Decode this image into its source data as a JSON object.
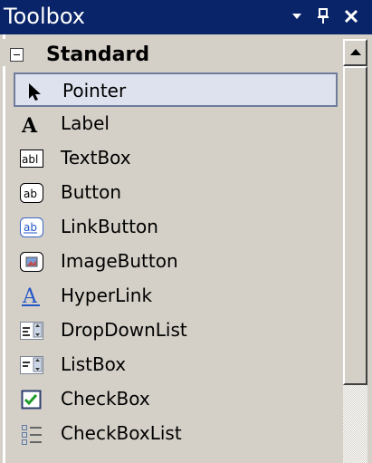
{
  "window": {
    "title": "Toolbox",
    "controls": {
      "dropdown": "▾",
      "pin": "ᚁ",
      "close": "✕"
    }
  },
  "group": {
    "label": "Standard",
    "expanded": true
  },
  "items": [
    {
      "label": "Pointer",
      "icon": "pointer-icon",
      "selected": true
    },
    {
      "label": "Label",
      "icon": "label-icon"
    },
    {
      "label": "TextBox",
      "icon": "textbox-icon"
    },
    {
      "label": "Button",
      "icon": "button-icon"
    },
    {
      "label": "LinkButton",
      "icon": "linkbutton-icon"
    },
    {
      "label": "ImageButton",
      "icon": "imagebutton-icon"
    },
    {
      "label": "HyperLink",
      "icon": "hyperlink-icon"
    },
    {
      "label": "DropDownList",
      "icon": "dropdownlist-icon"
    },
    {
      "label": "ListBox",
      "icon": "listbox-icon"
    },
    {
      "label": "CheckBox",
      "icon": "checkbox-icon"
    },
    {
      "label": "CheckBoxList",
      "icon": "checkboxlist-icon"
    }
  ],
  "colors": {
    "titlebar": "#0a246a",
    "panel": "#d4d0c8",
    "selection": "#dde2ee",
    "selection_border": "#6f7c9c"
  }
}
